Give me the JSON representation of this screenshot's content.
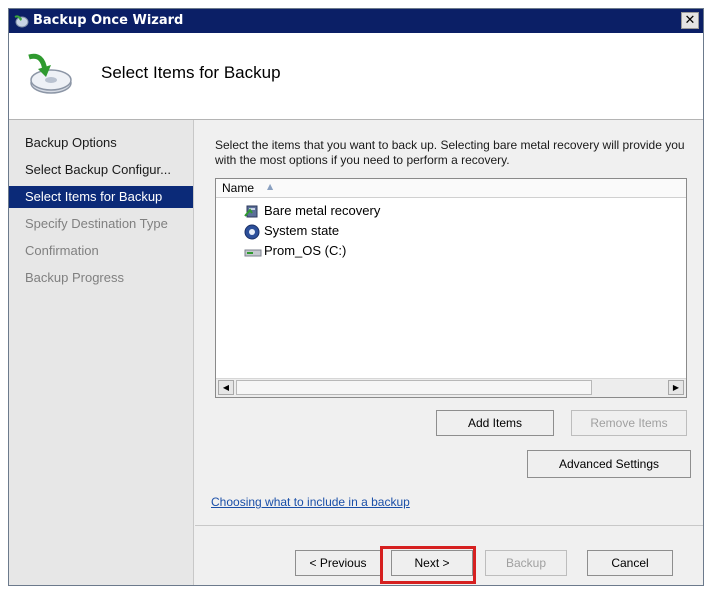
{
  "window": {
    "title": "Backup Once Wizard",
    "close_glyph": "✕"
  },
  "header": {
    "heading": "Select Items for Backup",
    "icon": "backup-wizard-icon"
  },
  "nav": {
    "items": [
      {
        "label": "Backup Options",
        "state": "normal"
      },
      {
        "label": "Select Backup Configur...",
        "state": "normal"
      },
      {
        "label": "Select Items for Backup",
        "state": "active"
      },
      {
        "label": "Specify Destination Type",
        "state": "disabled"
      },
      {
        "label": "Confirmation",
        "state": "disabled"
      },
      {
        "label": "Backup Progress",
        "state": "disabled"
      }
    ]
  },
  "content": {
    "description": "Select the items that you want to back up. Selecting bare metal recovery will provide you with the most options if you need to perform a recovery.",
    "list": {
      "column_header": "Name",
      "items": [
        {
          "label": "Bare metal recovery",
          "icon": "bare-metal-icon"
        },
        {
          "label": "System state",
          "icon": "system-state-icon"
        },
        {
          "label": "Prom_OS (C:)",
          "icon": "drive-icon"
        }
      ]
    },
    "buttons": {
      "add_items": "Add Items",
      "remove_items": "Remove Items",
      "advanced_settings": "Advanced Settings"
    },
    "help_link": "Choosing what to include in a backup"
  },
  "footer": {
    "previous": "< Previous",
    "next": "Next >",
    "backup": "Backup",
    "cancel": "Cancel"
  },
  "colors": {
    "title_bar": "#0b1f66",
    "nav_active": "#0b2a78",
    "highlight": "#d62020",
    "link": "#1a4fa8"
  }
}
